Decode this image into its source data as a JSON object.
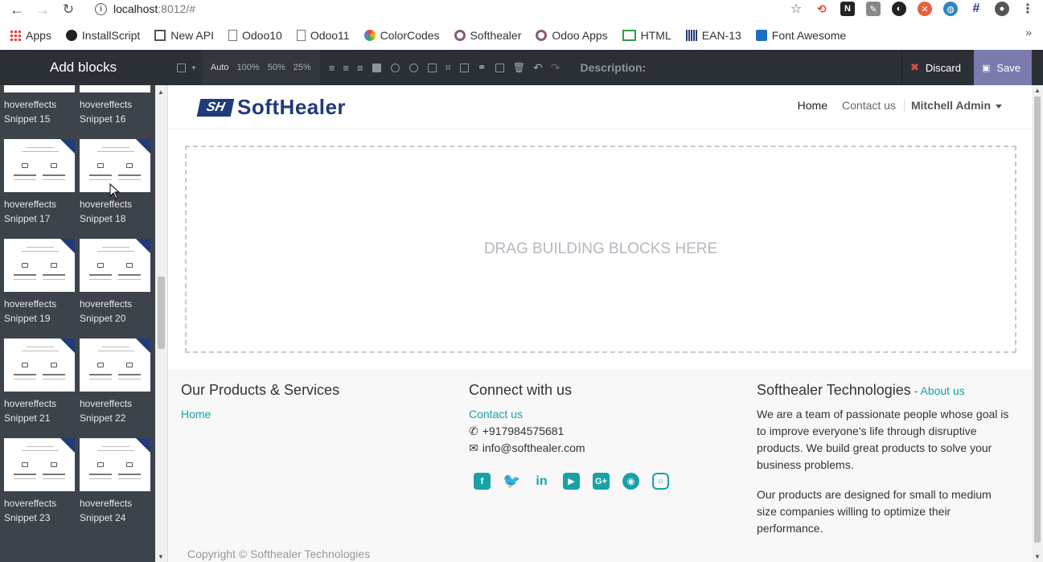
{
  "browser": {
    "url_host": "localhost",
    "url_rest": ":8012/#",
    "bookmarks": [
      {
        "label": "Apps",
        "icon": "apps-grid-icon",
        "color": "#e94235"
      },
      {
        "label": "InstallScript",
        "icon": "github-icon",
        "color": "#222222"
      },
      {
        "label": "New API",
        "icon": "book-icon",
        "color": "#555555"
      },
      {
        "label": "Odoo10",
        "icon": "page-icon",
        "color": "#777777"
      },
      {
        "label": "Odoo11",
        "icon": "page-icon",
        "color": "#777777"
      },
      {
        "label": "ColorCodes",
        "icon": "colorwheel-icon",
        "color": "#e94235"
      },
      {
        "label": "Softhealer",
        "icon": "odoo-circle-icon",
        "color": "#875a7b"
      },
      {
        "label": "Odoo Apps",
        "icon": "odoo-circle-icon",
        "color": "#875a7b"
      },
      {
        "label": "HTML",
        "icon": "html-icon",
        "color": "#2ea043"
      },
      {
        "label": "EAN-13",
        "icon": "barcode-icon",
        "color": "#1f3b7a"
      },
      {
        "label": "Font Awesome",
        "icon": "flag-icon",
        "color": "#1c6ec3"
      }
    ]
  },
  "editor": {
    "sidebar_title": "Add blocks",
    "snippets": [
      {
        "name": "hovereffects",
        "sub": "Snippet 15"
      },
      {
        "name": "hovereffects",
        "sub": "Snippet 16"
      },
      {
        "name": "hovereffects",
        "sub": "Snippet 17"
      },
      {
        "name": "hovereffects",
        "sub": "Snippet 18"
      },
      {
        "name": "hovereffects",
        "sub": "Snippet 19"
      },
      {
        "name": "hovereffects",
        "sub": "Snippet 20"
      },
      {
        "name": "hovereffects",
        "sub": "Snippet 21"
      },
      {
        "name": "hovereffects",
        "sub": "Snippet 22"
      },
      {
        "name": "hovereffects",
        "sub": "Snippet 23"
      },
      {
        "name": "hovereffects",
        "sub": "Snippet 24"
      }
    ],
    "toolbar": {
      "zoom_auto": "Auto",
      "zoom_100": "100%",
      "zoom_50": "50%",
      "zoom_25": "25%",
      "description": "Description:"
    },
    "discard_label": "Discard",
    "save_label": "Save"
  },
  "site": {
    "logo_mark": "SH",
    "logo_text": "SoftHealer",
    "menu": {
      "home": "Home",
      "contact": "Contact us",
      "user": "Mitchell Admin"
    },
    "dropzone_text": "DRAG BUILDING BLOCKS HERE",
    "footer": {
      "col1_title": "Our Products & Services",
      "col1_link": "Home",
      "col2_title": "Connect with us",
      "col2_link": "Contact us",
      "phone": "+917984575681",
      "email": "info@softhealer.com",
      "col3_title": "Softhealer Technologies",
      "col3_dash": " - ",
      "col3_link": "About us",
      "para1": "We are a team of passionate people whose goal is to improve everyone's life through disruptive products. We build great products to solve your business problems.",
      "para2": "Our products are designed for small to medium size companies willing to optimize their performance.",
      "copyright": "Copyright © Softhealer Technologies"
    },
    "accent": "#17a2a5"
  }
}
